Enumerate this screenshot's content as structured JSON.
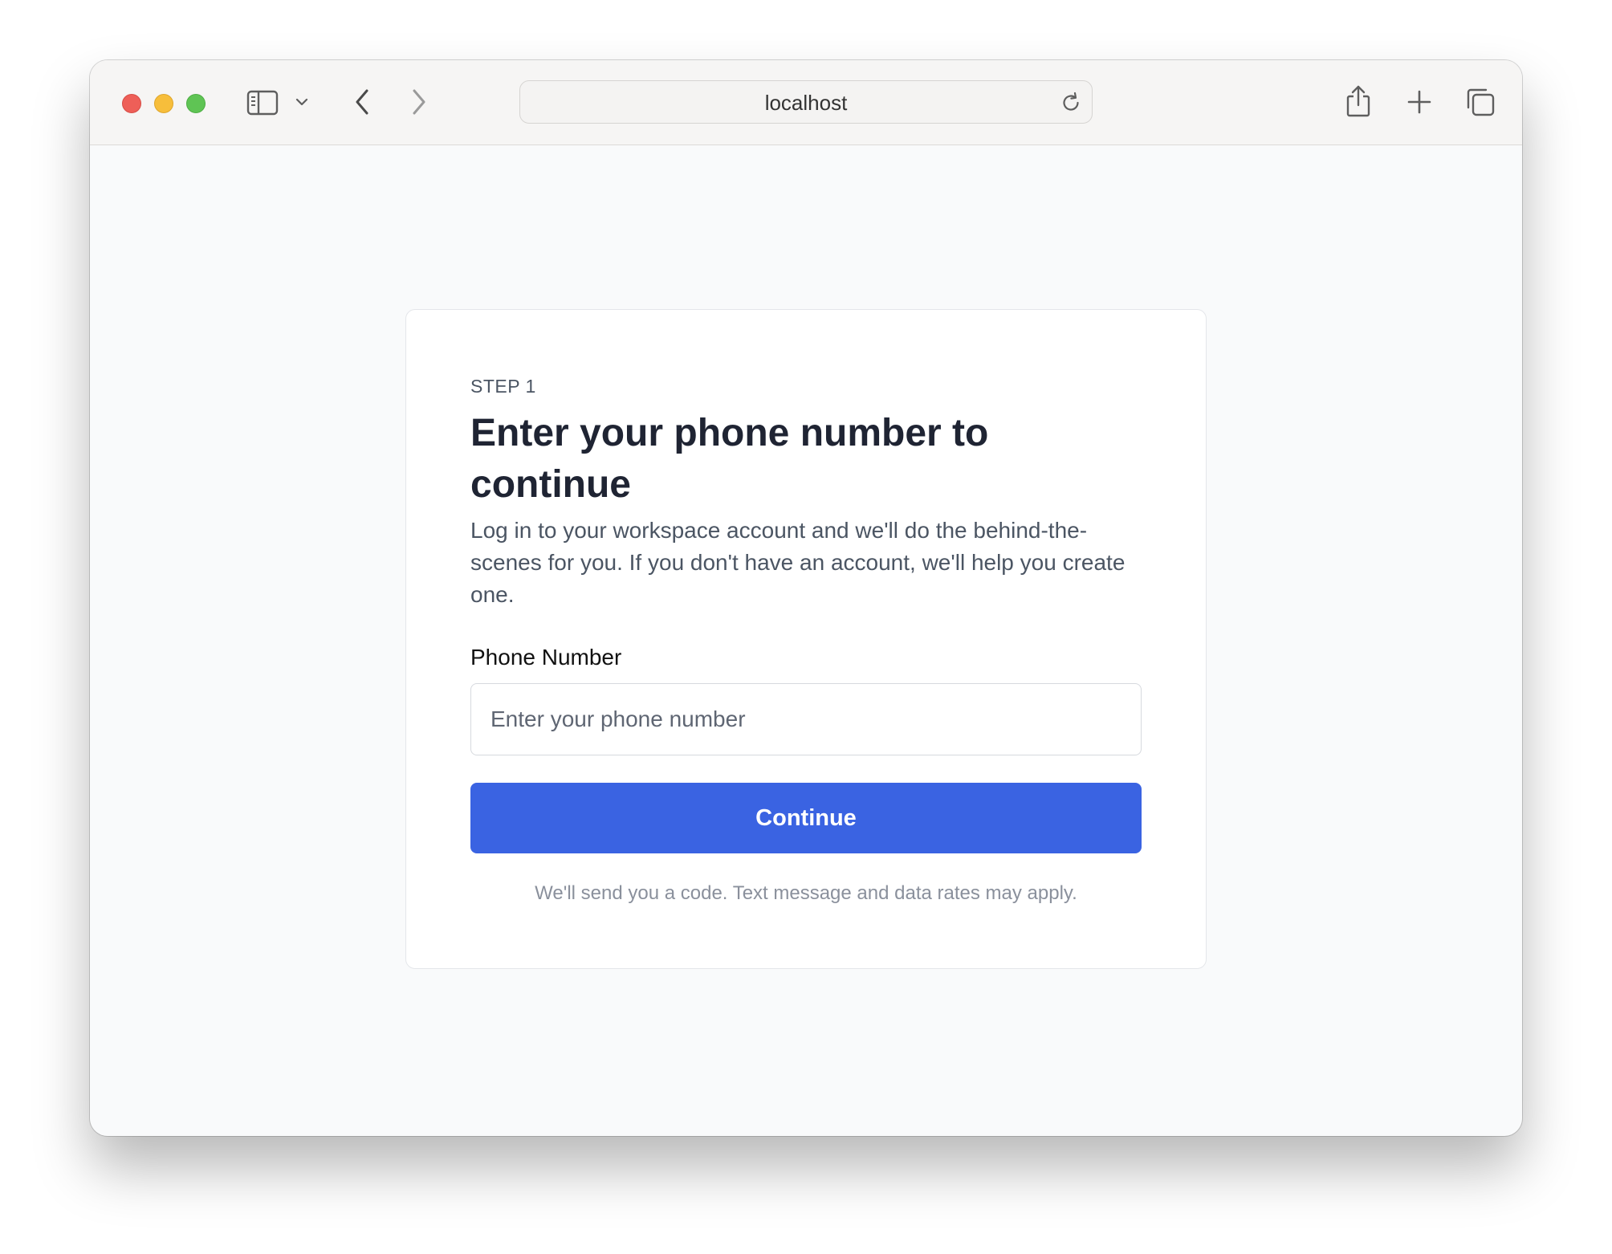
{
  "browser": {
    "url": "localhost",
    "icons": {
      "close": "close-button-red",
      "minimize": "minimize-button-yellow",
      "maximize": "maximize-button-green",
      "sidebar": "sidebar-icon",
      "sidebar_menu": "chevron-down-icon",
      "back": "chevron-left-icon",
      "forward": "chevron-right-icon",
      "reload": "reload-icon",
      "share": "share-icon",
      "new_tab": "plus-icon",
      "tabs_overview": "tabs-icon"
    }
  },
  "card": {
    "step_label": "STEP 1",
    "title": "Enter your phone number to continue",
    "description": "Log in to your workspace account and we'll do the behind-the-scenes for you. If you don't have an account, we'll help you create one.",
    "phone_field": {
      "label": "Phone Number",
      "placeholder": "Enter your phone number",
      "value": ""
    },
    "continue_label": "Continue",
    "disclaimer": "We'll send you a code. Text message and data rates may apply."
  },
  "colors": {
    "primary_button": "#3a63e2",
    "page_background": "#f9fafb",
    "heading_text": "#1f2433",
    "muted_text": "#8a909c"
  }
}
